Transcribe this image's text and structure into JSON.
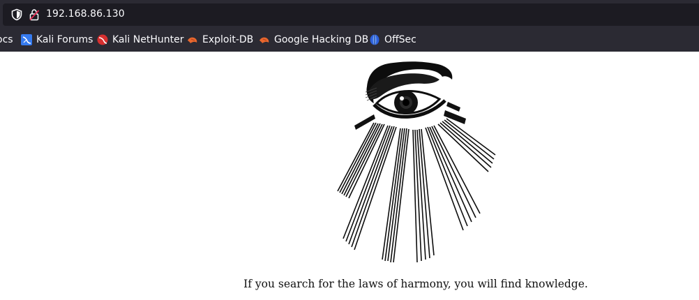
{
  "browser": {
    "url": "192.168.86.130",
    "bookmarks": [
      {
        "label": "ocs",
        "icon": "docs-icon"
      },
      {
        "label": "Kali Forums",
        "icon": "kali-forums-icon"
      },
      {
        "label": "Kali NetHunter",
        "icon": "kali-nethunter-icon"
      },
      {
        "label": "Exploit-DB",
        "icon": "exploit-db-icon"
      },
      {
        "label": "Google Hacking DB",
        "icon": "google-hacking-db-icon"
      },
      {
        "label": "OffSec",
        "icon": "offsec-icon"
      }
    ]
  },
  "page": {
    "image_icon": "all-seeing-eye",
    "quote": "If you search for the laws of harmony, you will find knowledge."
  },
  "colors": {
    "chrome_bg": "#2b2a33",
    "urlbar_bg": "#1c1b22",
    "text_light": "#fbfbfe",
    "page_bg": "#ffffff"
  }
}
